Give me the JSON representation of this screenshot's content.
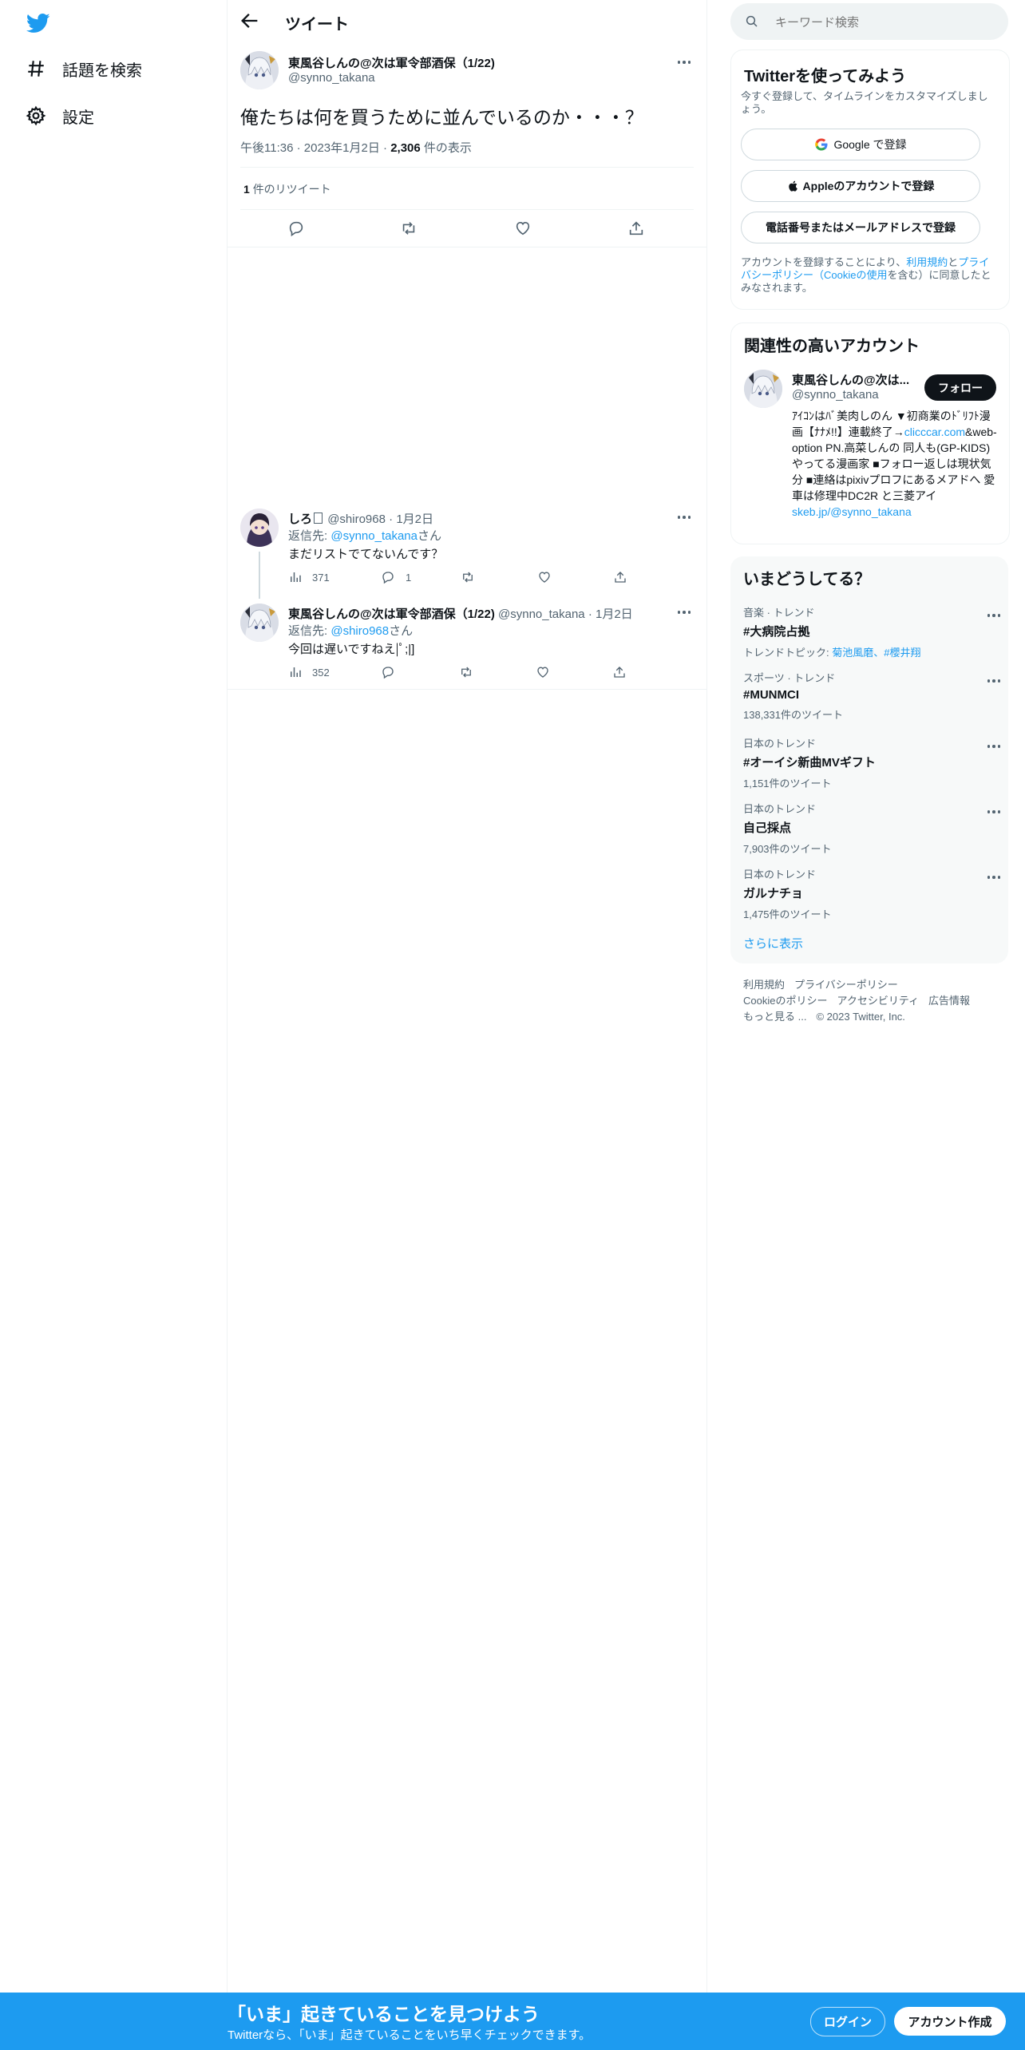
{
  "sidebar": {
    "items": [
      {
        "label": "話題を検索",
        "icon": "hashtag-icon"
      },
      {
        "label": "設定",
        "icon": "gear-icon"
      }
    ]
  },
  "header": {
    "title": "ツイート"
  },
  "tweet": {
    "author_name": "東風谷しんの@次は軍令部酒保（1/22)",
    "author_handle": "@synno_takana",
    "text": "俺たちは何を買うために並んでいるのか・・・？",
    "time": "午後11:36",
    "date": "2023年1月2日",
    "views_count": "2,306",
    "views_label": "件の表示",
    "retweets_count": "1",
    "retweets_label": "件のリツイート"
  },
  "replies": [
    {
      "name": "しろ",
      "handle": "@shiro968",
      "date": "1月2日",
      "reply_prefix": "返信先: ",
      "reply_to": "@synno_takana",
      "reply_suffix": "さん",
      "text": "まだリストでてないんです？",
      "views": "371",
      "replies": "1"
    },
    {
      "name": "東風谷しんの@次は軍令部酒保（1/22)",
      "handle": "@synno_takana",
      "date": "1月2日",
      "reply_prefix": "返信先: ",
      "reply_to": "@shiro968",
      "reply_suffix": "さん",
      "text": "今回は遅いですねえ|ﾟ;|]",
      "views": "352"
    }
  ],
  "search": {
    "placeholder": "キーワード検索"
  },
  "signup": {
    "title": "Twitterを使ってみよう",
    "subtitle": "今すぐ登録して、タイムラインをカスタマイズしましょう。",
    "google": "Google で登録",
    "apple": "Appleのアカウントで登録",
    "phone": "電話番号またはメールアドレスで登録",
    "terms_1": "アカウントを登録することにより、",
    "terms_link_1": "利用規約",
    "terms_2": "と",
    "terms_link_2": "プライバシーポリシー（Cookieの使用",
    "terms_3": "を含む）に同意したとみなされます。"
  },
  "relevant": {
    "title": "関連性の高いアカウント",
    "name": "東風谷しんの@次は...",
    "handle": "@synno_takana",
    "follow": "フォロー",
    "bio_1": "ｱｲｺﾝはﾊﾞ美肉しのん ▼初商業のﾄﾞﾘﾌﾄ漫画【ﾅﾅﾒ!!】連載終了→",
    "bio_link": "clicccar.com",
    "bio_2": "&web-option PN.高菜しんの 同人も(GP-KIDS)やってる漫画家 ■フォロー返しは現状気分 ■連絡はpixivプロフにあるメアドへ 愛車は修理中DC2R と三菱アイ",
    "bio_link_2": "skeb.jp/@synno_takana"
  },
  "trends": {
    "title": "いまどうしてる？",
    "items": [
      {
        "meta": "音楽 · トレンド",
        "name": "#大病院占拠",
        "sub_prefix": "トレンドトピック: ",
        "sub_link": "菊池風磨、#櫻井翔"
      },
      {
        "meta": "スポーツ · トレンド",
        "name": "#MUNMCI",
        "sub": "138,331件のツイート"
      },
      {
        "meta": "日本のトレンド",
        "name": "#オーイシ新曲MVギフト",
        "sub": "1,151件のツイート"
      },
      {
        "meta": "日本のトレンド",
        "name": "自己採点",
        "sub": "7,903件のツイート"
      },
      {
        "meta": "日本のトレンド",
        "name": "ガルナチョ",
        "sub": "1,475件のツイート"
      }
    ],
    "show_more": "さらに表示"
  },
  "footer": {
    "links": [
      "利用規約",
      "プライバシーポリシー",
      "Cookieのポリシー",
      "アクセシビリティ",
      "広告情報",
      "もっと見る ..."
    ],
    "copyright": "© 2023 Twitter, Inc."
  },
  "bottombar": {
    "title": "「いま」起きていることを見つけよう",
    "subtitle": "Twitterなら、「いま」起きていることをいち早くチェックできます。",
    "login": "ログイン",
    "signup": "アカウント作成"
  },
  "colors": {
    "accent": "#1d9bf0",
    "text": "#0f1419",
    "secondary": "#536471",
    "border": "#eff3f4"
  }
}
